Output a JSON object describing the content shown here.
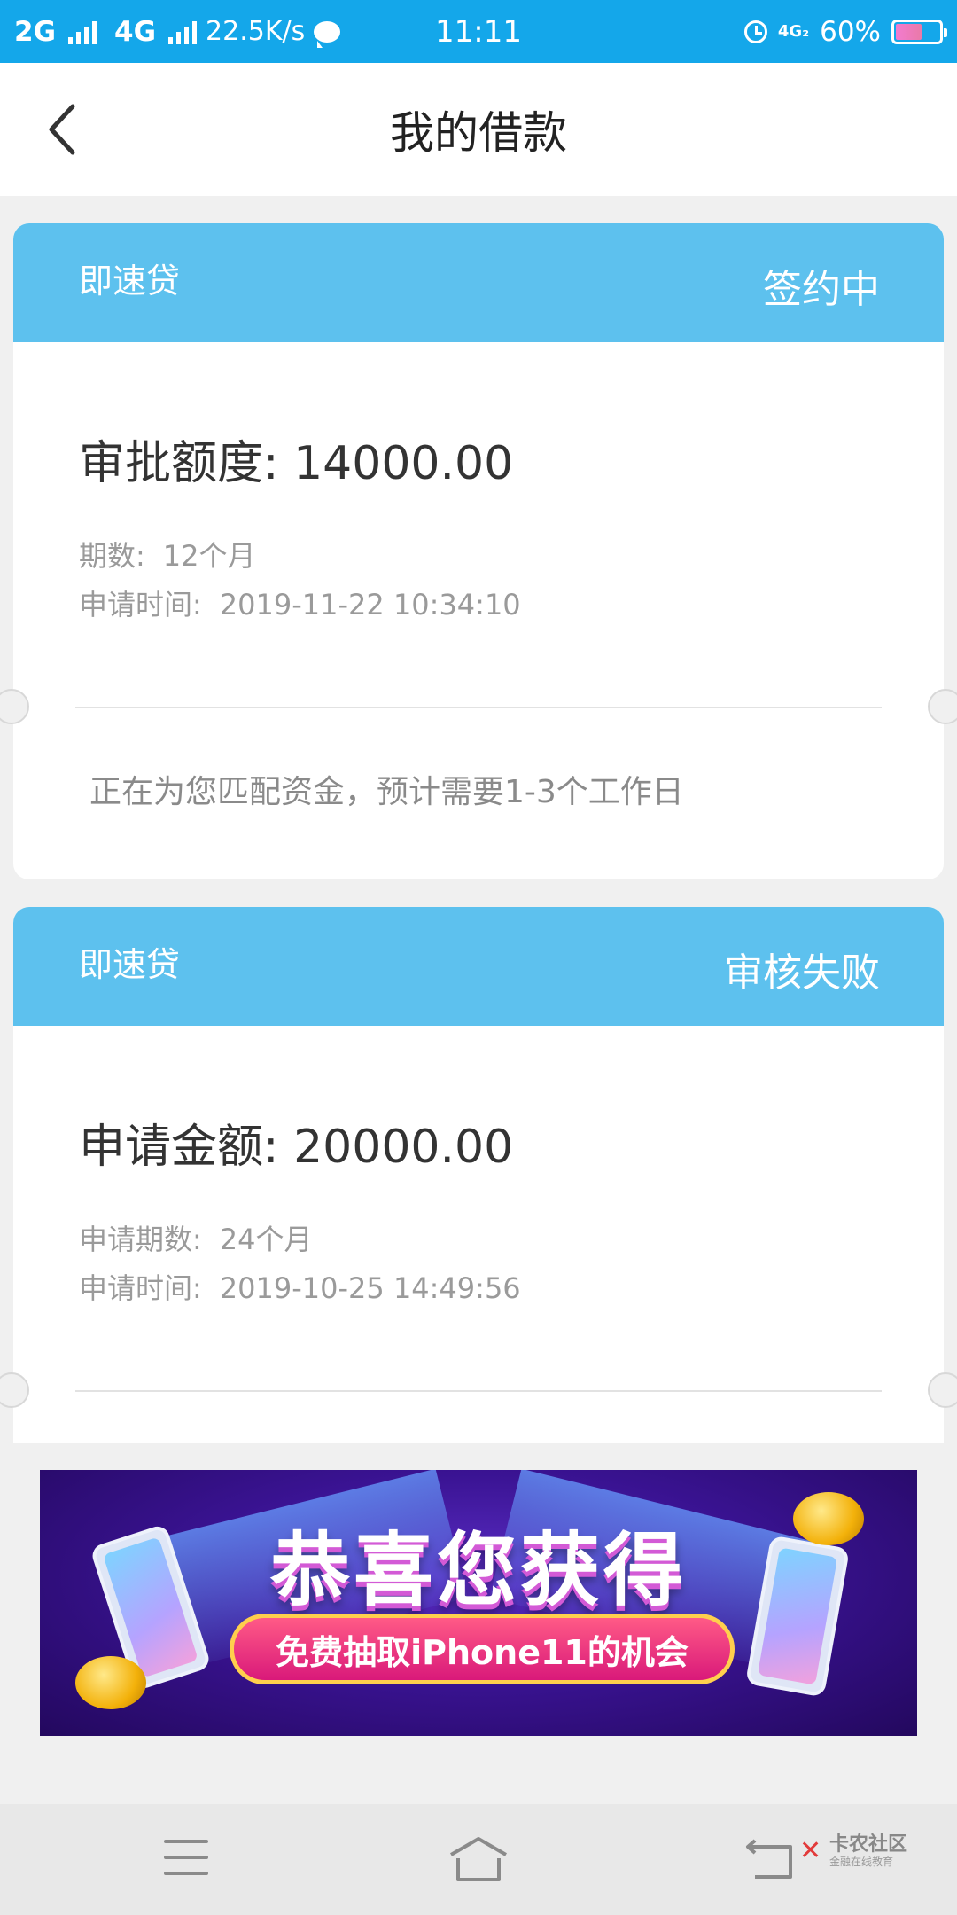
{
  "status_bar": {
    "net1": "2G",
    "net2": "4G",
    "speed": "22.5K/s",
    "time": "11:11",
    "net_small": "4G₂",
    "battery": "60%",
    "battery_level": 0.6
  },
  "header": {
    "title": "我的借款"
  },
  "loans": [
    {
      "product": "即速贷",
      "status": "签约中",
      "amount_label": "审批额度:",
      "amount": "14000.00",
      "periods_label": "期数:",
      "periods": "12个月",
      "time_label": "申请时间:",
      "time": "2019-11-22 10:34:10",
      "note": "正在为您匹配资金，预计需要1-3个工作日"
    },
    {
      "product": "即速贷",
      "status": "审核失败",
      "amount_label": "申请金额:",
      "amount": "20000.00",
      "periods_label": "申请期数:",
      "periods": "24个月",
      "time_label": "申请时间:",
      "time": "2019-10-25 14:49:56"
    }
  ],
  "banner": {
    "title": "恭喜您获得",
    "subtitle": "免费抽取iPhone11的机会"
  },
  "watermark": {
    "name": "卡农社区",
    "sub": "金融在线教育"
  },
  "colors": {
    "status_bar": "#14a7ea",
    "card_header": "#5dc1ee"
  }
}
